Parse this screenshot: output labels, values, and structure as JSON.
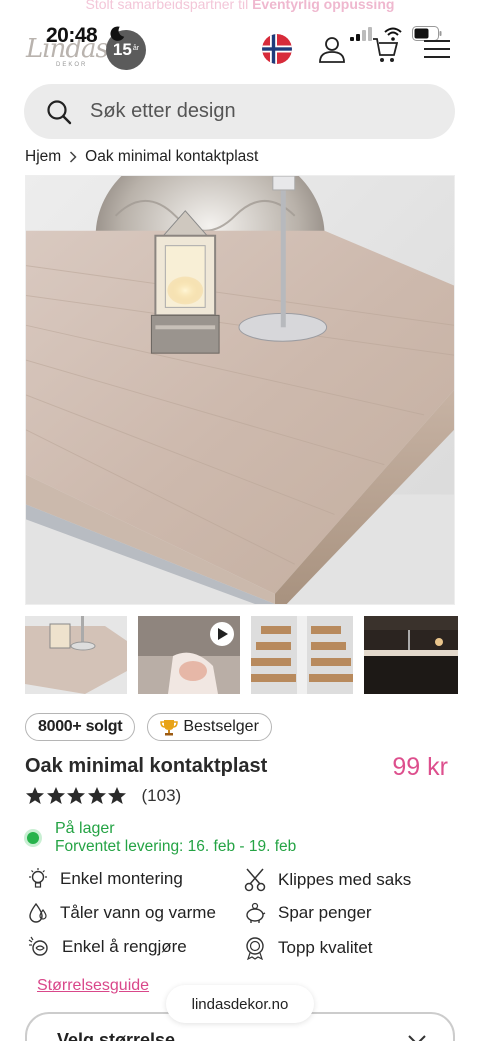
{
  "promo": {
    "prefix": "Stolt samarbeidspartner til ",
    "brand": "Eventyrlig oppussing"
  },
  "status_bar": {
    "time": "20:48"
  },
  "logo": {
    "script": "Lindas",
    "sub": "DEKOR",
    "badge_number": "15",
    "badge_suffix": "år"
  },
  "header": {
    "icons": [
      "norway-flag",
      "user-icon",
      "cart-icon",
      "menu-icon"
    ]
  },
  "search": {
    "placeholder": "Søk etter design"
  },
  "breadcrumb": {
    "home": "Hjem",
    "current": "Oak minimal kontaktplast"
  },
  "product": {
    "badge_sold": "8000+ solgt",
    "badge_best": "Bestselger",
    "title": "Oak minimal kontaktplast",
    "price": "99 kr",
    "rating": 5,
    "reviews": "(103)",
    "stock_label": "På lager",
    "delivery": "Forventet levering: 16. feb - 19. feb",
    "size_guide": "Størrelsesguide",
    "size_select": "Velg størrelse"
  },
  "features": [
    {
      "label": "Enkel montering",
      "icon": "bulb-icon"
    },
    {
      "label": "Klippes med saks",
      "icon": "scissors-icon"
    },
    {
      "label": "Tåler vann og varme",
      "icon": "droplet-icon"
    },
    {
      "label": "Spar penger",
      "icon": "piggy-bank-icon"
    },
    {
      "label": "Enkel å rengjøre",
      "icon": "cleaning-icon"
    },
    {
      "label": "Topp kvalitet",
      "icon": "quality-award-icon"
    }
  ],
  "browser": {
    "site": "lindasdekor.no"
  },
  "colors": {
    "accent": "#dd4f8d",
    "stock_green": "#24a344"
  }
}
